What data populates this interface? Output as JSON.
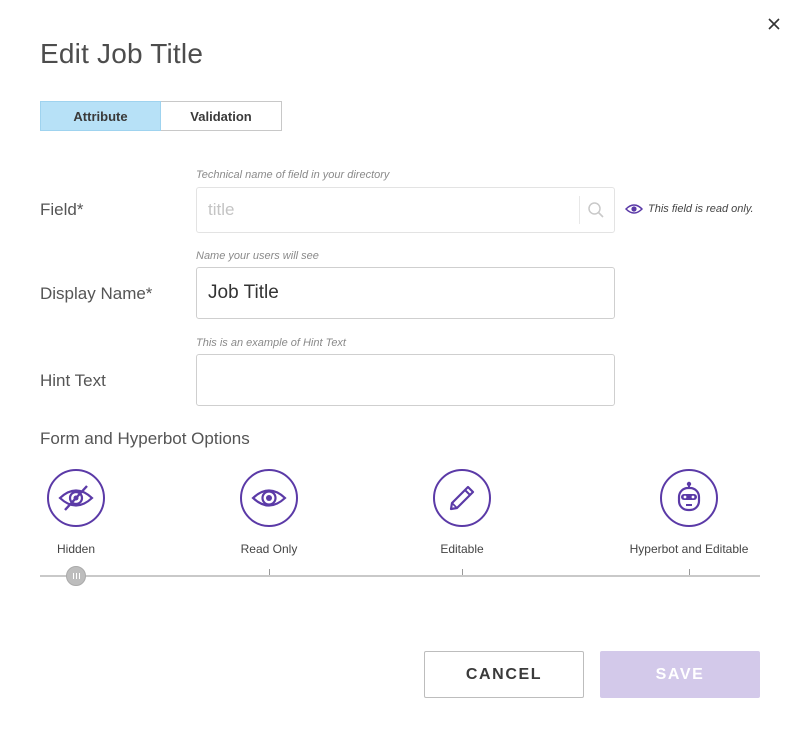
{
  "dialog": {
    "title": "Edit Job Title",
    "close_icon": "close-icon"
  },
  "tabs": [
    {
      "label": "Attribute",
      "active": true
    },
    {
      "label": "Validation",
      "active": false
    }
  ],
  "fields": {
    "field": {
      "label": "Field*",
      "helper": "Technical name of field in your directory",
      "placeholder": "title",
      "read_only_note": "This field is read only."
    },
    "display_name": {
      "label": "Display Name*",
      "helper": "Name your users will see",
      "value": "Job Title"
    },
    "hint_text": {
      "label": "Hint Text",
      "helper": "This is an example of Hint Text",
      "value": ""
    }
  },
  "options": {
    "title": "Form and Hyperbot Options",
    "items": [
      {
        "label": "Hidden",
        "icon": "eye-slash-icon"
      },
      {
        "label": "Read Only",
        "icon": "eye-icon"
      },
      {
        "label": "Editable",
        "icon": "pencil-icon"
      },
      {
        "label": "Hyperbot and Editable",
        "icon": "robot-icon"
      }
    ],
    "selected_index": 0
  },
  "buttons": {
    "cancel": "CANCEL",
    "save": "SAVE"
  },
  "colors": {
    "accent": "#5b3aa7",
    "tab_active_bg": "#b7e1f7",
    "save_disabled_bg": "#d3c9ea"
  }
}
